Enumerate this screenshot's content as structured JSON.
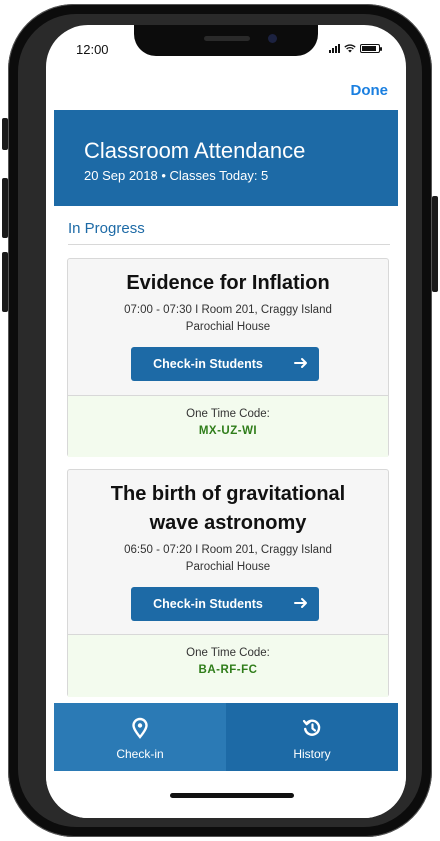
{
  "status_bar": {
    "time": "12:00"
  },
  "nav": {
    "done_label": "Done"
  },
  "header": {
    "title": "Classroom Attendance",
    "subtitle": "20 Sep 2018 • Classes Today: 5"
  },
  "section": {
    "label": "In Progress"
  },
  "classes": [
    {
      "title_line1": "Evidence for Inflation",
      "title_line2": "",
      "meta_line1": "07:00 - 07:30 I Room 201, Craggy Island",
      "meta_line2": "Parochial House",
      "button_label": "Check-in Students",
      "code_label": "One Time Code:",
      "code_value": "MX-UZ-WI"
    },
    {
      "title_line1": "The birth of gravitational",
      "title_line2": "wave astronomy",
      "meta_line1": "06:50 - 07:20 I Room 201, Craggy Island",
      "meta_line2": "Parochial House",
      "button_label": "Check-in Students",
      "code_label": "One Time Code:",
      "code_value": "BA-RF-FC"
    }
  ],
  "tabbar": {
    "tabs": [
      {
        "label": "Check-in",
        "icon": "location-pin-icon",
        "active": true
      },
      {
        "label": "History",
        "icon": "history-icon",
        "active": false
      }
    ]
  },
  "colors": {
    "primary": "#1d6aa6",
    "tab_active": "#2b7ab5",
    "link": "#1a7fe0",
    "code_background": "#f3fbee",
    "code_text": "#2f7d1a"
  }
}
